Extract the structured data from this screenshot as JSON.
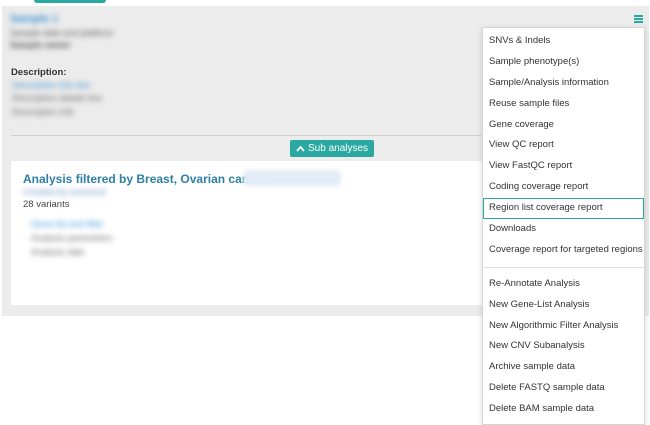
{
  "sample": {
    "name": "Sample 1",
    "line1": "Sample date and platform",
    "line2": "Sample owner"
  },
  "description": {
    "label": "Description:",
    "line1": "Description link text",
    "line2": "Description details line",
    "line3": "Description info"
  },
  "sub_analyses_button": "Sub analyses",
  "analysis": {
    "title": "Analysis filtered by Breast, Ovarian cancer",
    "subtitle": "Created by someone",
    "variants": "28 variants",
    "blur1": "Gene list and filter",
    "blur2": "Analysis parameters",
    "blur3": "Analysis date"
  },
  "menu": {
    "icon": "hamburger-menu-icon",
    "group1": [
      "SNVs & Indels",
      "Sample phenotype(s)",
      "Sample/Analysis information",
      "Reuse sample files",
      "Gene coverage",
      "View QC report",
      "View FastQC report",
      "Coding coverage report",
      "Region list coverage report",
      "Downloads",
      "Coverage report for targeted regions"
    ],
    "group2": [
      "Re-Annotate Analysis",
      "New Gene-List Analysis",
      "New Algorithmic Filter Analysis",
      "New CNV Subanalysis",
      "Archive sample data",
      "Delete FASTQ sample data",
      "Delete BAM sample data"
    ],
    "active_item": "Region list coverage report"
  },
  "colors": {
    "accent": "#2aa9a2",
    "link": "#2f7fa5"
  }
}
